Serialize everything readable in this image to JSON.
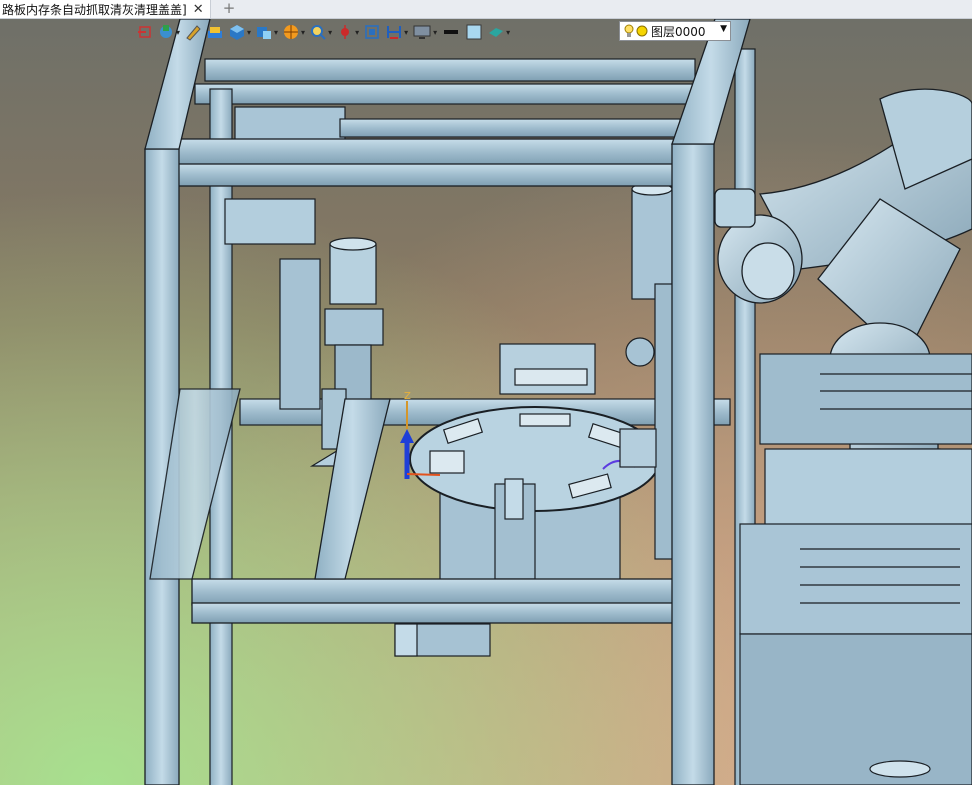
{
  "tab": {
    "title": "路板内存条自动抓取清灰清理盖盖]",
    "close_glyph": "✕",
    "new_glyph": "+"
  },
  "toolbar": {
    "icons": [
      "exit-icon",
      "assembly-icon",
      "pencil-icon",
      "material-icon",
      "box-icon",
      "component-icon",
      "render-icon",
      "zoom-icon",
      "pointer-icon",
      "fit-view-icon",
      "dimension-icon",
      "display-icon",
      "line-color-icon",
      "fill-color-icon",
      "surface-color-icon"
    ],
    "layer": {
      "name": "图层0000"
    }
  },
  "scene": {
    "axis_label": "Z",
    "colors": {
      "frame": "#a9c5d6",
      "edge": "#1a1f24",
      "axis_z": "#1f3fd8",
      "accent": "#e2521d"
    }
  }
}
